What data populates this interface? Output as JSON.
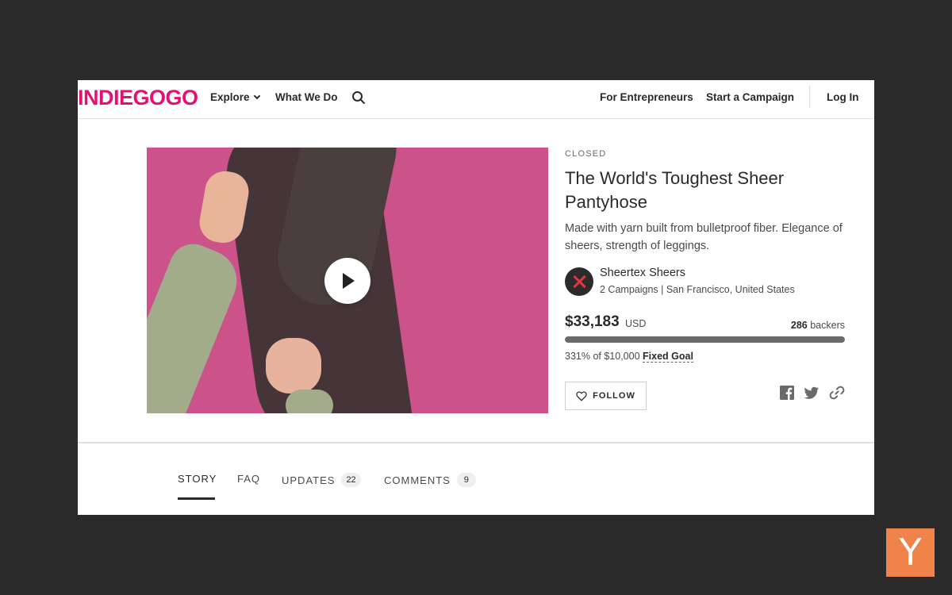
{
  "header": {
    "logo": "INDIEGOGO",
    "nav": {
      "explore": "Explore",
      "what_we_do": "What We Do",
      "for_entrepreneurs": "For Entrepreneurs",
      "start_campaign": "Start a Campaign",
      "login": "Log In"
    }
  },
  "campaign": {
    "status": "CLOSED",
    "title": "The World's Toughest Sheer Pantyhose",
    "tagline": "Made with yarn built from bulletproof fiber. Elegance of sheers, strength of leggings.",
    "owner": {
      "name": "Sheertex Sheers",
      "meta": "2 Campaigns | San Francisco, United States"
    },
    "funding": {
      "amount": "$33,183",
      "currency": "USD",
      "backers_count": "286",
      "backers_label": "backers",
      "progress_fraction": 1.0,
      "goal_text": "331% of $10,000",
      "goal_type": "Fixed Goal"
    },
    "follow_label": "FOLLOW"
  },
  "tabs": [
    {
      "label": "STORY"
    },
    {
      "label": "FAQ"
    },
    {
      "label": "UPDATES",
      "count": "22"
    },
    {
      "label": "COMMENTS",
      "count": "9"
    }
  ],
  "icons": {
    "search": "search-icon",
    "play": "play-icon",
    "heart": "heart-icon",
    "facebook": "facebook-icon",
    "twitter": "twitter-icon",
    "link": "link-icon"
  },
  "colors": {
    "brand": "#e51075",
    "yc_badge": "#f0834a"
  },
  "badge": {
    "letter": "Y"
  }
}
